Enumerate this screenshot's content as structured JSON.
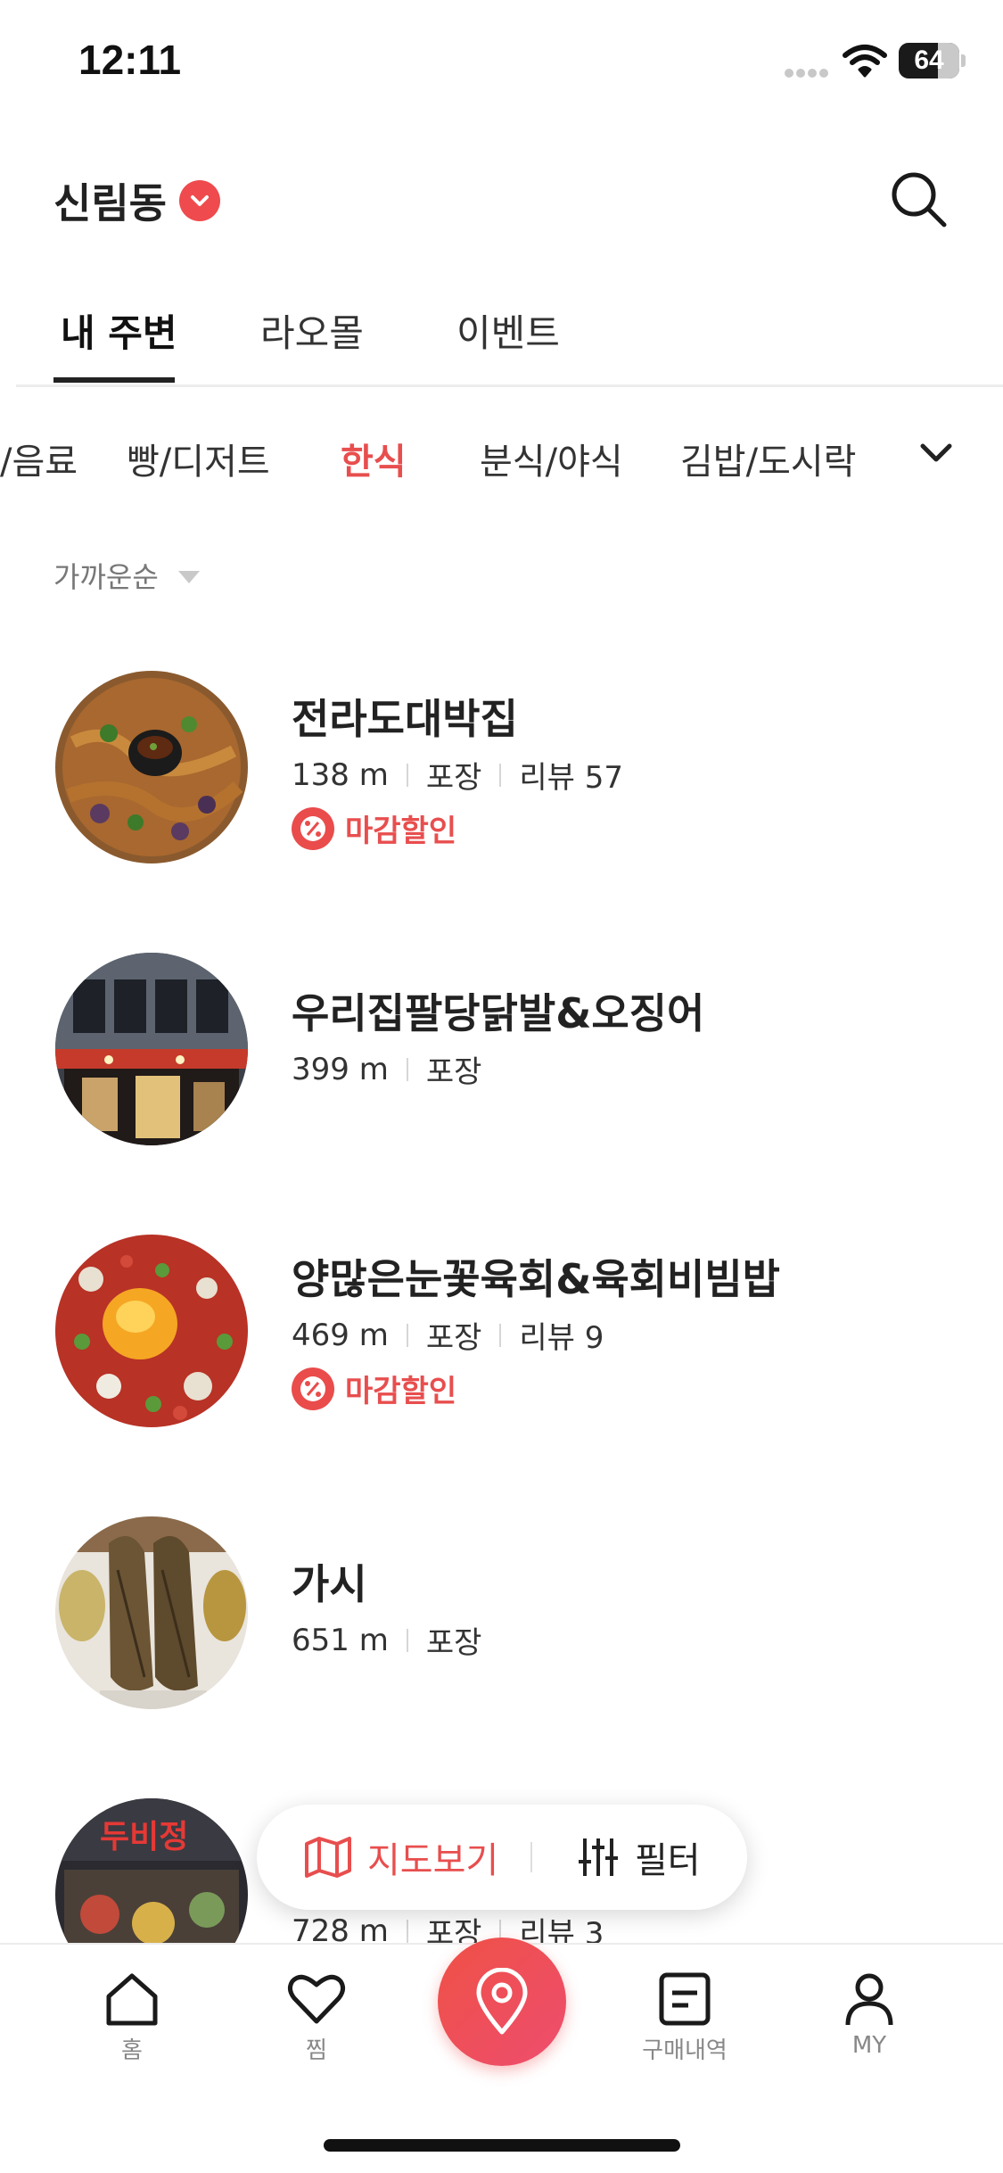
{
  "status_bar": {
    "time": "12:11",
    "battery": "64"
  },
  "header": {
    "location": "신림동",
    "location_icon": "chevron-down-icon",
    "search_icon": "search-icon"
  },
  "top_tabs": [
    {
      "label": "내 주변",
      "active": true
    },
    {
      "label": "라오몰",
      "active": false
    },
    {
      "label": "이벤트",
      "active": false
    }
  ],
  "categories": [
    {
      "label": "/음료",
      "active": false
    },
    {
      "label": "빵/디저트",
      "active": false
    },
    {
      "label": "한식",
      "active": true
    },
    {
      "label": "분식/야식",
      "active": false
    },
    {
      "label": "김밥/도시락",
      "active": false
    }
  ],
  "sort": {
    "label": "가까운순"
  },
  "stores": [
    {
      "name": "전라도대박집",
      "distance": "138 m",
      "service": "포장",
      "review": "리뷰 57",
      "badge": "마감할인"
    },
    {
      "name": "우리집팔당닭발&오징어",
      "distance": "399 m",
      "service": "포장"
    },
    {
      "name": "양많은눈꽃육회&육회비빔밥",
      "distance": "469 m",
      "service": "포장",
      "review": "리뷰 9",
      "badge": "마감할인"
    },
    {
      "name": "가시",
      "distance": "651 m",
      "service": "포장"
    },
    {
      "distance": "728 m",
      "service": "포장",
      "review": "리뷰 3",
      "sign_text": "두비정"
    }
  ],
  "floating": {
    "map_label": "지도보기",
    "filter_label": "필터"
  },
  "bottom_nav": [
    {
      "label": "홈",
      "icon": "home-icon"
    },
    {
      "label": "찜",
      "icon": "heart-icon"
    },
    {
      "label": "",
      "icon": "location-pin-icon"
    },
    {
      "label": "구매내역",
      "icon": "receipt-icon"
    },
    {
      "label": "MY",
      "icon": "profile-icon"
    }
  ],
  "colors": {
    "accent": "#e84e4e",
    "text": "#222222",
    "muted": "#888888"
  }
}
